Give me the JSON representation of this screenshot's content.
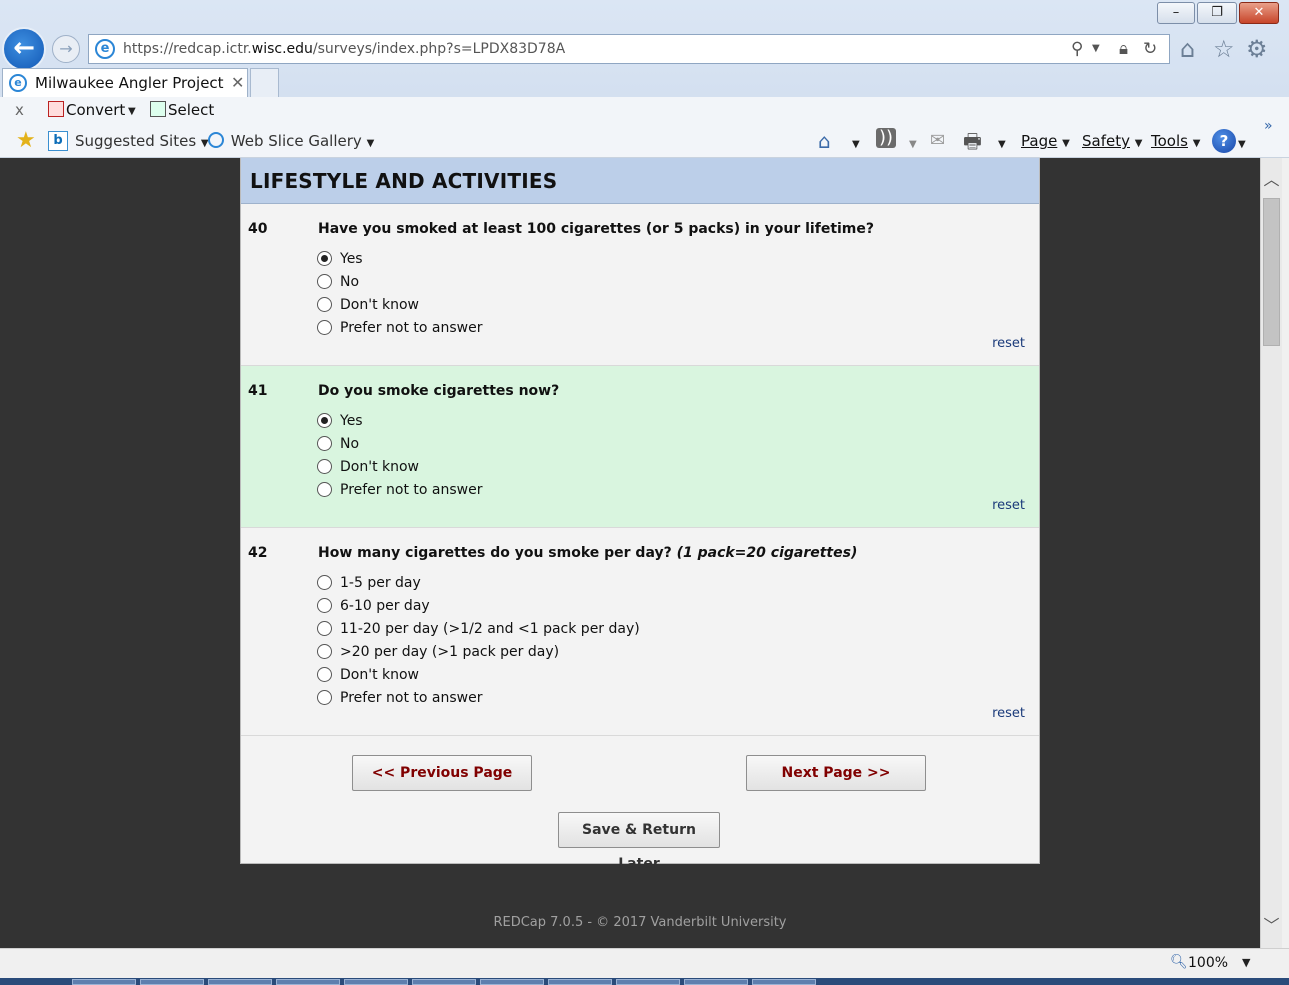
{
  "browser": {
    "url_prefix": "https://redcap.ictr.",
    "url_host": "wisc.edu",
    "url_path": "/surveys/index.php?s=LPDX83D78A",
    "tab_title": "Milwaukee Angler Project",
    "window_controls": {
      "minimize": "–",
      "maximize": "❐",
      "close": "✕"
    },
    "command_row1": {
      "close": "x",
      "convert": "Convert",
      "select": "Select"
    },
    "favorites": {
      "suggested_sites": "Suggested Sites",
      "web_slice_gallery": "Web Slice Gallery"
    },
    "menus": {
      "page": "Page",
      "safety": "Safety",
      "tools": "Tools"
    },
    "zoom": "100%"
  },
  "survey": {
    "section_title": "LIFESTYLE AND ACTIVITIES",
    "reset_label": "reset",
    "questions": [
      {
        "number": "40",
        "text": "Have you smoked at least 100 cigarettes (or 5 packs) in your lifetime?",
        "options": [
          "Yes",
          "No",
          "Don't know",
          "Prefer not to answer"
        ],
        "selected": "Yes",
        "highlight": false
      },
      {
        "number": "41",
        "text": "Do you smoke cigarettes now?",
        "options": [
          "Yes",
          "No",
          "Don't know",
          "Prefer not to answer"
        ],
        "selected": "Yes",
        "highlight": true
      },
      {
        "number": "42",
        "text": "How many cigarettes do you smoke per day?",
        "text_italic": "(1 pack=20 cigarettes)",
        "options": [
          "1-5 per day",
          "6-10 per day",
          "11-20 per day (>1/2 and <1 pack per day)",
          ">20 per day (>1 pack per day)",
          "Don't know",
          "Prefer not to answer"
        ],
        "selected": null,
        "highlight": false
      }
    ],
    "buttons": {
      "previous": "<< Previous Page",
      "next": "Next Page >>",
      "save": "Save & Return Later"
    },
    "footer": "REDCap 7.0.5 - © 2017 Vanderbilt University"
  },
  "colors": {
    "section_header_bg": "#bccfe9",
    "highlight_bg": "#d9f5df",
    "nav_button_text": "#800000",
    "page_bg": "#333333"
  }
}
